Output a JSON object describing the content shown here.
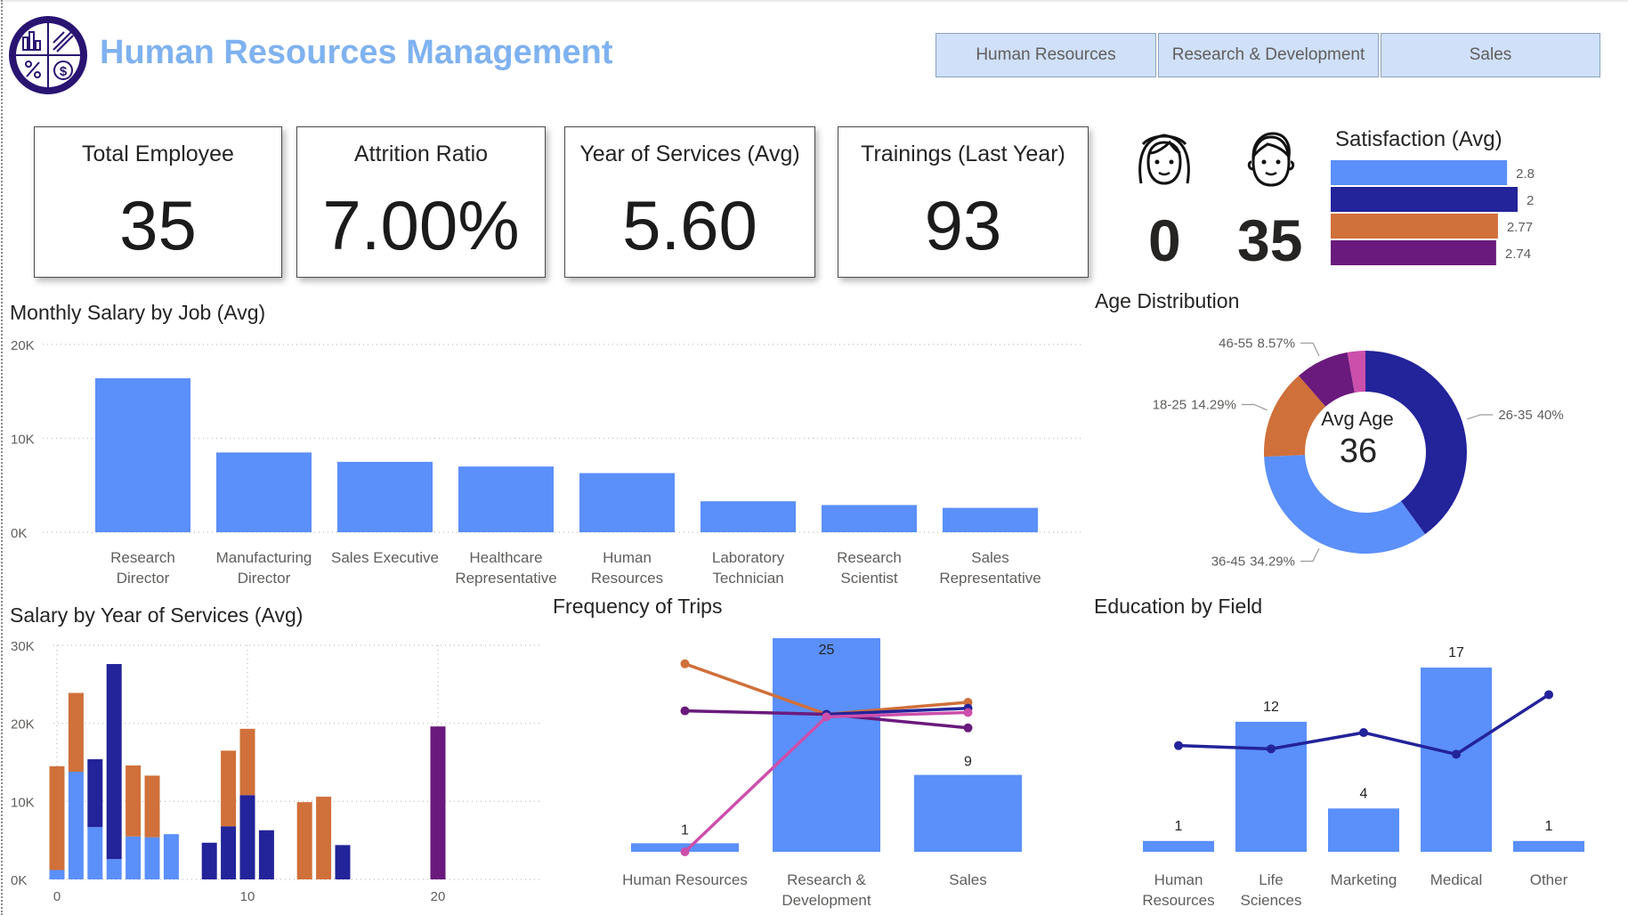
{
  "header": {
    "title": "Human Resources Management",
    "logo_icon": "hr-analytics-logo-icon",
    "department_buttons": [
      "Human Resources",
      "Research & Development",
      "Sales"
    ]
  },
  "kpis": [
    {
      "label": "Total Employee",
      "value": "35"
    },
    {
      "label": "Attrition Ratio",
      "value": "7.00%"
    },
    {
      "label": "Year of Services (Avg)",
      "value": "5.60"
    },
    {
      "label": "Trainings (Last Year)",
      "value": "93"
    }
  ],
  "gender": {
    "female_icon": "female-avatar-icon",
    "male_icon": "male-avatar-icon",
    "female_count": "0",
    "male_count": "35"
  },
  "colors": {
    "blue": "#5b8ff9",
    "navy": "#23239a",
    "orange": "#d0703a",
    "purple": "#6a1a7c",
    "pink": "#cc4fac",
    "title_blue": "#7fb2f0"
  },
  "chart_data": [
    {
      "id": "satisfaction",
      "type": "bar",
      "orientation": "horizontal",
      "title": "Satisfaction (Avg)",
      "values": [
        2.86,
        2.91,
        2.77,
        2.74
      ],
      "colors": [
        "#5b8ff9",
        "#23239a",
        "#d0703a",
        "#6a1a7c"
      ]
    },
    {
      "id": "salary_by_job",
      "type": "bar",
      "title": "Monthly Salary by Job (Avg)",
      "categories": [
        [
          "Research",
          "Director"
        ],
        [
          "Manufacturing",
          "Director"
        ],
        [
          "Sales Executive"
        ],
        [
          "Healthcare",
          "Representative"
        ],
        [
          "Human",
          "Resources"
        ],
        [
          "Laboratory",
          "Technician"
        ],
        [
          "Research",
          "Scientist"
        ],
        [
          "Sales",
          "Representative"
        ]
      ],
      "values": [
        16400,
        8500,
        7500,
        7000,
        6300,
        3300,
        2900,
        2600
      ],
      "yticks": [
        "0K",
        "10K",
        "20K"
      ],
      "ylim": [
        0,
        20000
      ],
      "grid": true
    },
    {
      "id": "age_distribution",
      "type": "pie",
      "title": "Age Distribution",
      "center_label": "Avg Age",
      "center_value": "36",
      "slices": [
        {
          "label": "26-35",
          "percent": 40,
          "pct_text": "40%",
          "color": "#23239a"
        },
        {
          "label": "36-45",
          "percent": 34.29,
          "pct_text": "34.29%",
          "color": "#5b8ff9"
        },
        {
          "label": "18-25",
          "percent": 14.29,
          "pct_text": "14.29%",
          "color": "#d0703a"
        },
        {
          "label": "46-55",
          "percent": 8.57,
          "pct_text": "8.57%",
          "color": "#6a1a7c"
        },
        {
          "label": "",
          "percent": 2.86,
          "pct_text": "",
          "color": "#cc4fac"
        }
      ]
    },
    {
      "id": "salary_by_years",
      "type": "bar",
      "title": "Salary by Year of Services (Avg)",
      "xticks": [
        0,
        10,
        20
      ],
      "xlim": [
        0,
        25
      ],
      "yticks": [
        "0K",
        "10K",
        "20K",
        "30K"
      ],
      "ylim": [
        0,
        30000
      ],
      "grid": true,
      "bars": [
        {
          "x": 0,
          "segments": [
            {
              "color": "#5b8ff9",
              "value": 1200
            },
            {
              "color": "#d0703a",
              "value": 13300
            }
          ]
        },
        {
          "x": 1,
          "segments": [
            {
              "color": "#5b8ff9",
              "value": 13800
            },
            {
              "color": "#d0703a",
              "value": 10100
            }
          ]
        },
        {
          "x": 2,
          "segments": [
            {
              "color": "#5b8ff9",
              "value": 6700
            },
            {
              "color": "#23239a",
              "value": 8700
            }
          ]
        },
        {
          "x": 3,
          "segments": [
            {
              "color": "#5b8ff9",
              "value": 2600
            },
            {
              "color": "#23239a",
              "value": 25000
            }
          ]
        },
        {
          "x": 4,
          "segments": [
            {
              "color": "#5b8ff9",
              "value": 5500
            },
            {
              "color": "#d0703a",
              "value": 9100
            }
          ]
        },
        {
          "x": 5,
          "segments": [
            {
              "color": "#5b8ff9",
              "value": 5400
            },
            {
              "color": "#d0703a",
              "value": 7900
            }
          ]
        },
        {
          "x": 6,
          "segments": [
            {
              "color": "#5b8ff9",
              "value": 5800
            }
          ]
        },
        {
          "x": 8,
          "segments": [
            {
              "color": "#23239a",
              "value": 4700
            }
          ]
        },
        {
          "x": 9,
          "segments": [
            {
              "color": "#23239a",
              "value": 6800
            },
            {
              "color": "#d0703a",
              "value": 9700
            }
          ]
        },
        {
          "x": 10,
          "segments": [
            {
              "color": "#23239a",
              "value": 10800
            },
            {
              "color": "#d0703a",
              "value": 8500
            }
          ]
        },
        {
          "x": 11,
          "segments": [
            {
              "color": "#23239a",
              "value": 6300
            }
          ]
        },
        {
          "x": 13,
          "segments": [
            {
              "color": "#d0703a",
              "value": 9900
            }
          ]
        },
        {
          "x": 14,
          "segments": [
            {
              "color": "#d0703a",
              "value": 10600
            }
          ]
        },
        {
          "x": 15,
          "segments": [
            {
              "color": "#23239a",
              "value": 4400
            }
          ]
        },
        {
          "x": 20,
          "segments": [
            {
              "color": "#6a1a7c",
              "value": 19600
            }
          ]
        }
      ]
    },
    {
      "id": "frequency_of_trips",
      "type": "bar",
      "title": "Frequency of Trips",
      "categories": [
        [
          "Human Resources"
        ],
        [
          "Research &",
          "Development"
        ],
        [
          "Sales"
        ]
      ],
      "values": [
        1,
        25,
        9
      ],
      "labels": [
        "1",
        "25",
        "9"
      ],
      "ylim": [
        0,
        25
      ],
      "grid": false,
      "lines": [
        {
          "color": "#d0703a",
          "values": [
            22,
            16.1,
            17.5
          ]
        },
        {
          "color": "#6a1a7c",
          "values": [
            16.5,
            16.1,
            14.5
          ]
        },
        {
          "color": "#23239a",
          "values": [
            null,
            16.1,
            16.8
          ]
        },
        {
          "color": "#cc4fac",
          "values": [
            0,
            15.8,
            16.3
          ]
        }
      ]
    },
    {
      "id": "education_by_field",
      "type": "bar",
      "title": "Education by Field",
      "categories": [
        [
          "Human",
          "Resources"
        ],
        [
          "Life",
          "Sciences"
        ],
        [
          "Marketing"
        ],
        [
          "Medical"
        ],
        [
          "Other"
        ]
      ],
      "values": [
        1,
        12,
        4,
        17,
        1
      ],
      "labels": [
        "1",
        "12",
        "4",
        "17",
        "1"
      ],
      "ylim": [
        0,
        17
      ],
      "grid": false,
      "line": {
        "color": "#23239a",
        "values": [
          9.8,
          9.5,
          11.0,
          9.0,
          14.5
        ]
      }
    }
  ]
}
